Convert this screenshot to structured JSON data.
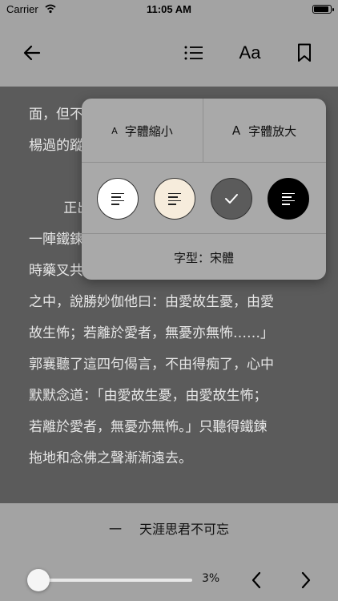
{
  "status_bar": {
    "carrier": "Carrier",
    "time": "11:05 AM",
    "battery_level": 1.0
  },
  "toolbar": {
    "back_icon": "back-arrow-icon",
    "toc_icon": "list-icon",
    "font_label": "Aa",
    "bookmark_icon": "bookmark-icon"
  },
  "reader": {
    "text": "面，但不\n楊過的蹤\n\n        正出\n一陣鐵鍊\n時藥叉共\n之中，說勝妙伽他曰：由愛故生憂，由愛\n故生怖；若離於愛者，無憂亦無怖……」\n郭襄聽了這四句偈言，不由得痴了，心中\n默默念道：「由愛故生憂，由愛故生怖；\n若離於愛者，無憂亦無怖。」只聽得鐵鍊\n拖地和念佛之聲漸漸遠去。\n\n        郭襄低聲道：「我要問他，如何才能"
  },
  "settings_popup": {
    "decrease_font_label": "字體縮小",
    "increase_font_label": "字體放大",
    "small_a": "A",
    "large_a": "A",
    "themes": [
      {
        "name": "white",
        "background": "#ffffff",
        "line_color": "#222222",
        "selected": false
      },
      {
        "name": "sepia",
        "background": "#f6ecdc",
        "line_color": "#222222",
        "selected": false
      },
      {
        "name": "dark-gray",
        "background": "#5b5b5b",
        "line_color": "#ffffff",
        "selected": true
      },
      {
        "name": "black",
        "background": "#000000",
        "line_color": "#ffffff",
        "selected": false
      }
    ],
    "font_type_label": "字型：宋體"
  },
  "footer": {
    "chapter_dash": "一",
    "chapter_title": "天涯思君不可忘",
    "progress": 0.03,
    "progress_label": "3%",
    "accent_color": "#2f7ef5",
    "prev_icon": "chevron-left-icon",
    "next_icon": "chevron-right-icon"
  }
}
